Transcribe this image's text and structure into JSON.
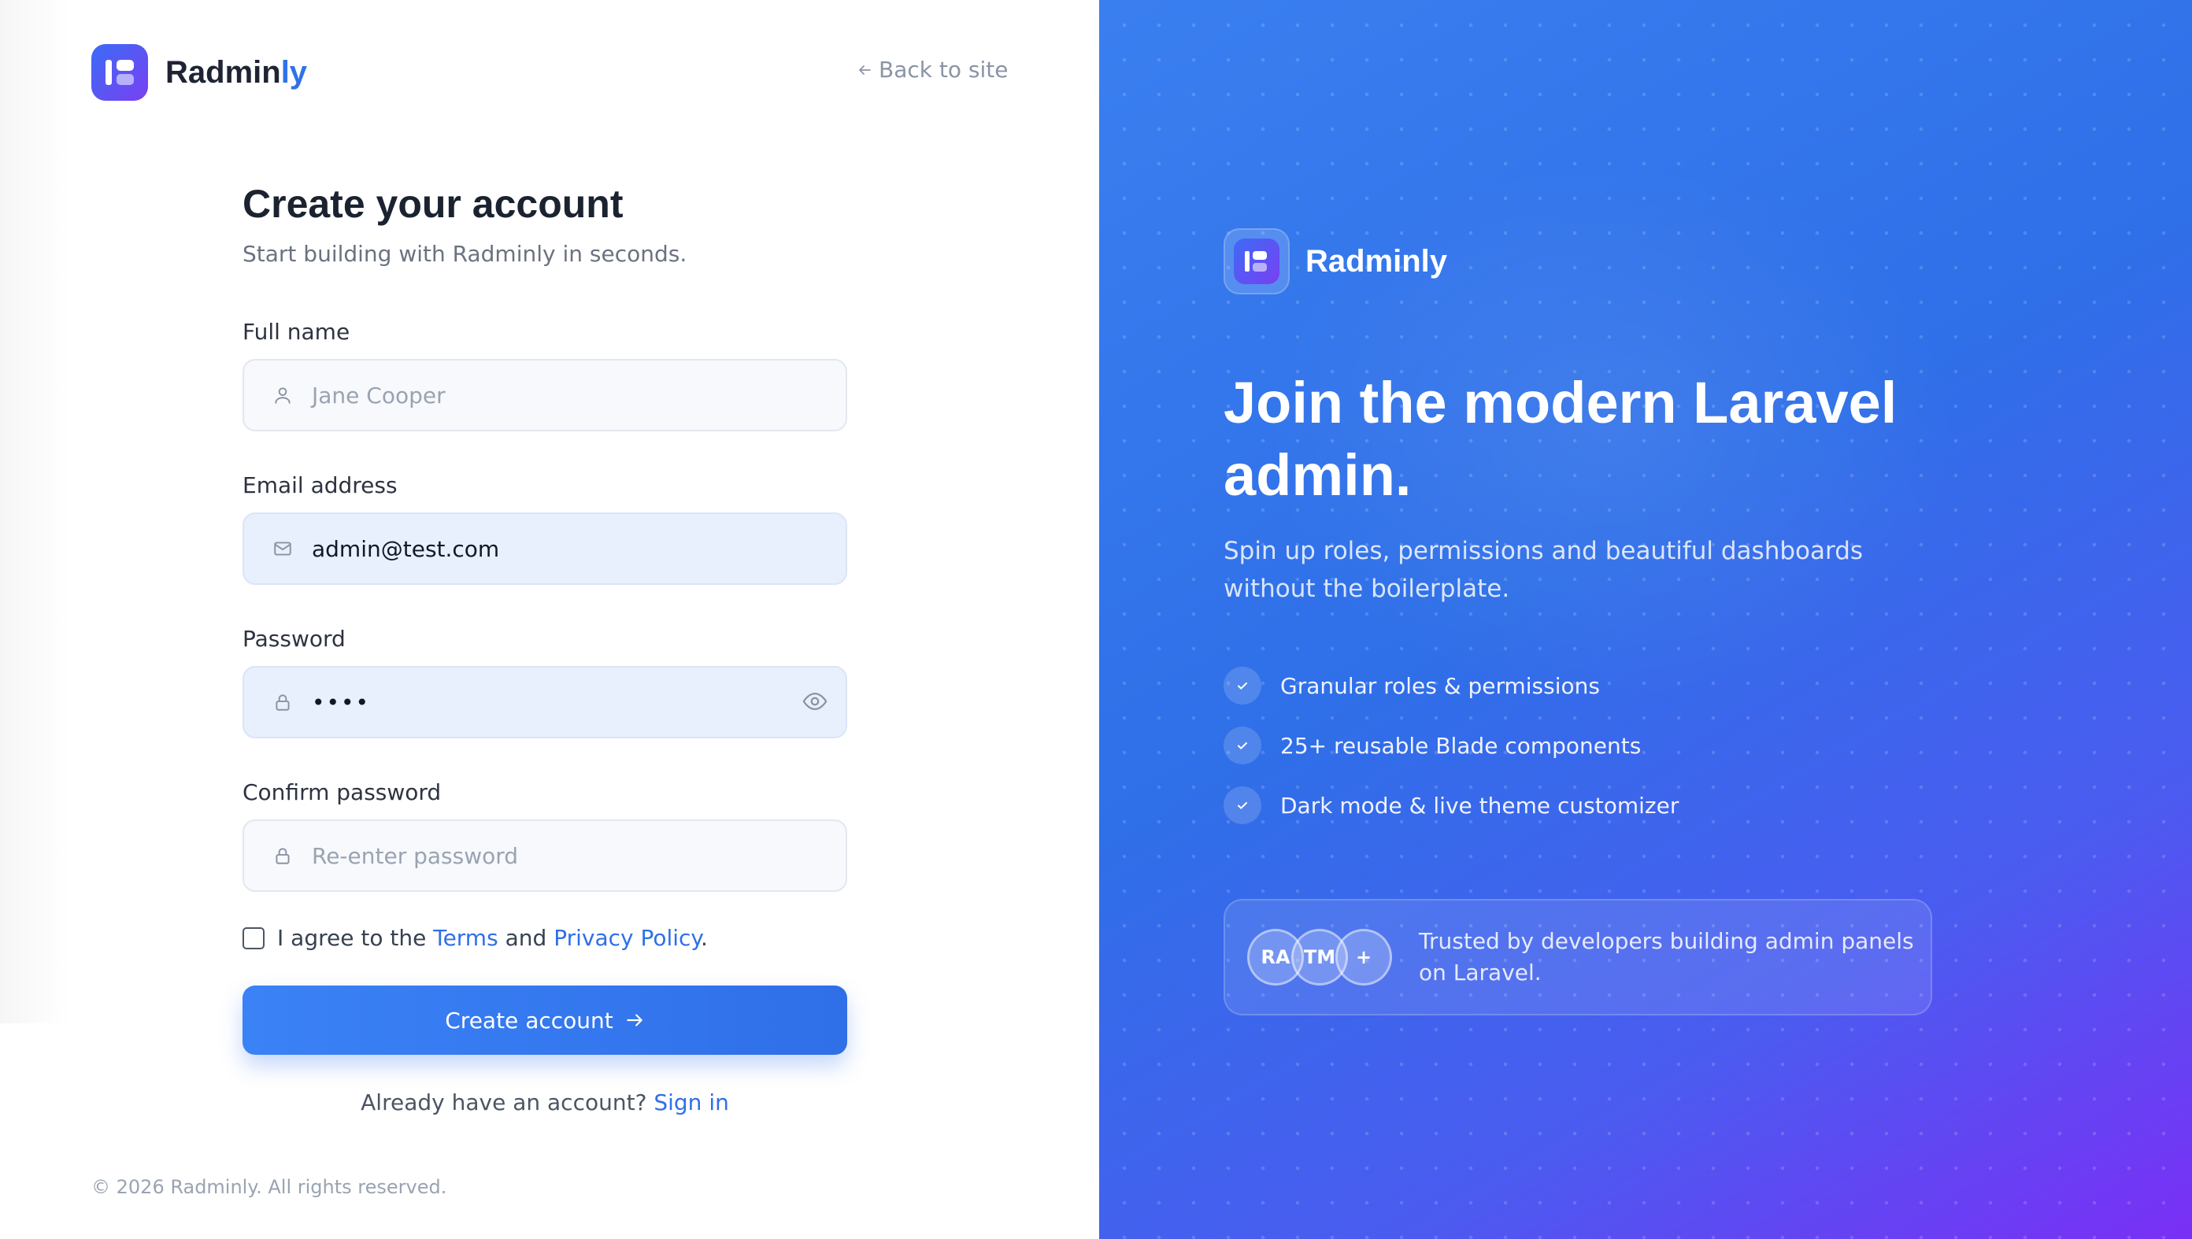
{
  "brand": {
    "name_main": "Radmin",
    "name_accent": "ly"
  },
  "header": {
    "back_label": "Back to site"
  },
  "form": {
    "title": "Create your account",
    "subtitle": "Start building with Radminly in seconds.",
    "full_name": {
      "label": "Full name",
      "placeholder": "Jane Cooper"
    },
    "email": {
      "label": "Email address",
      "value": "admin@test.com"
    },
    "password": {
      "label": "Password",
      "value": "••••"
    },
    "confirm": {
      "label": "Confirm password",
      "placeholder": "Re-enter password"
    },
    "agree": {
      "prefix": "I agree to the",
      "terms": "Terms",
      "and": "and",
      "privacy": "Privacy Policy",
      "suffix": "."
    },
    "submit_label": "Create account",
    "signin_prompt": "Already have an account?",
    "signin_link": "Sign in"
  },
  "footer": {
    "copyright": "© 2026 Radminly. All rights reserved."
  },
  "promo": {
    "brand_name": "Radminly",
    "headline": "Join the modern Laravel admin.",
    "lead": "Spin up roles, permissions and beautiful dashboards without the boilerplate.",
    "features": [
      "Granular roles & permissions",
      "25+ reusable Blade components",
      "Dark mode & live theme customizer"
    ],
    "avatars": [
      "RA",
      "TM",
      "+"
    ],
    "trust_text": "Trusted by developers building admin panels on Laravel."
  },
  "colors": {
    "accent": "#2f6fe8",
    "panel_start": "#3a7ff0",
    "panel_end": "#7a2ff5"
  },
  "icons": [
    "user-icon",
    "mail-icon",
    "lock-icon",
    "eye-icon",
    "arrow-left-icon",
    "arrow-right-icon",
    "check-icon"
  ]
}
